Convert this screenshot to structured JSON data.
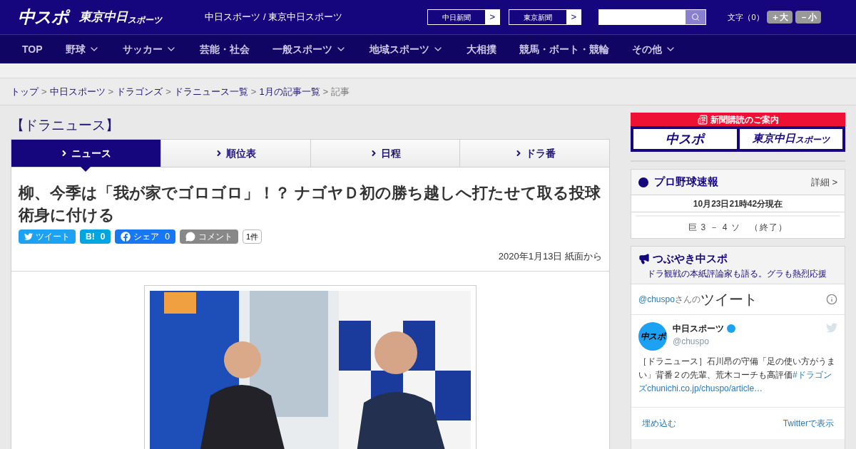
{
  "header": {
    "logo_main": "中スポ",
    "logo_tokyo": "東京中日",
    "logo_tokyo_small": "スポーツ",
    "site_title": "中日スポーツ / 東京中日スポーツ",
    "links": [
      {
        "label": "中日新聞",
        "arrow": ">"
      },
      {
        "label": "東京新聞",
        "arrow": ">"
      }
    ],
    "font_size_label": "文字（0）",
    "font_buttons": [
      "＋大",
      "－小"
    ]
  },
  "nav": [
    {
      "label": "TOP",
      "dropdown": false
    },
    {
      "label": "野球",
      "dropdown": true
    },
    {
      "label": "サッカー",
      "dropdown": true
    },
    {
      "label": "芸能・社会",
      "dropdown": false
    },
    {
      "label": "一般スポーツ",
      "dropdown": true
    },
    {
      "label": "地域スポーツ",
      "dropdown": true
    },
    {
      "label": "大相撲",
      "dropdown": false
    },
    {
      "label": "競馬・ボート・競輪",
      "dropdown": false
    },
    {
      "label": "その他",
      "dropdown": true
    }
  ],
  "breadcrumb": {
    "links": [
      "トップ",
      "中日スポーツ",
      "ドラゴンズ",
      "ドラニュース一覧",
      "1月の記事一覧"
    ],
    "current": "記事",
    "separator": ">"
  },
  "section_title": "【ドラニュース】",
  "tabs": [
    {
      "label": "ニュース",
      "selected": true
    },
    {
      "label": "順位表",
      "selected": false
    },
    {
      "label": "日程",
      "selected": false
    },
    {
      "label": "ドラ番",
      "selected": false
    }
  ],
  "article": {
    "headline": "柳、今季は「我が家でゴロゴロ」！？ ナゴヤＤ初の勝ち越しへ打たせて取る投球術身に付ける",
    "share_buttons": [
      {
        "kind": "twitter",
        "label": "ツイート"
      },
      {
        "kind": "hatena",
        "label": "B!",
        "count": "0"
      },
      {
        "kind": "facebook",
        "label": "シェア",
        "count": "0"
      },
      {
        "kind": "comment",
        "label": "コメント"
      }
    ],
    "comment_count": "1件",
    "date": "2020年1月13日 紙面から"
  },
  "sidebar": {
    "subscribe": {
      "title": "新聞購読のご案内",
      "logo_main": "中スポ",
      "logo_tokyo": "東京中日",
      "logo_tokyo_small": "スポーツ"
    },
    "baseball": {
      "title": "プロ野球速報",
      "detail_link": "詳細 >",
      "updated": "10月23日21時42分現在",
      "score": "巨 3 － 4 ソ　（終了）"
    },
    "tweets": {
      "title": "つぶやき中スポ",
      "subtitle": "ドラ観戦の本紙評論家も語る。グラも熱烈応援",
      "widget_handle": "@chuspo",
      "widget_suffix": "さんの",
      "widget_title": "ツイート",
      "author": "中日スポーツ",
      "author_avatar": "中スポ",
      "handle": "@chuspo",
      "verified": true,
      "text": "［ドラニュース］石川昂の守備「足の使い方がうまい」背番２の先輩、荒木コーチも高評価",
      "hashtag": "#ドラゴンズ",
      "link": "chunichi.co.jp/chuspo/article…",
      "embed": "埋め込む",
      "view": "Twitterで表示"
    }
  }
}
